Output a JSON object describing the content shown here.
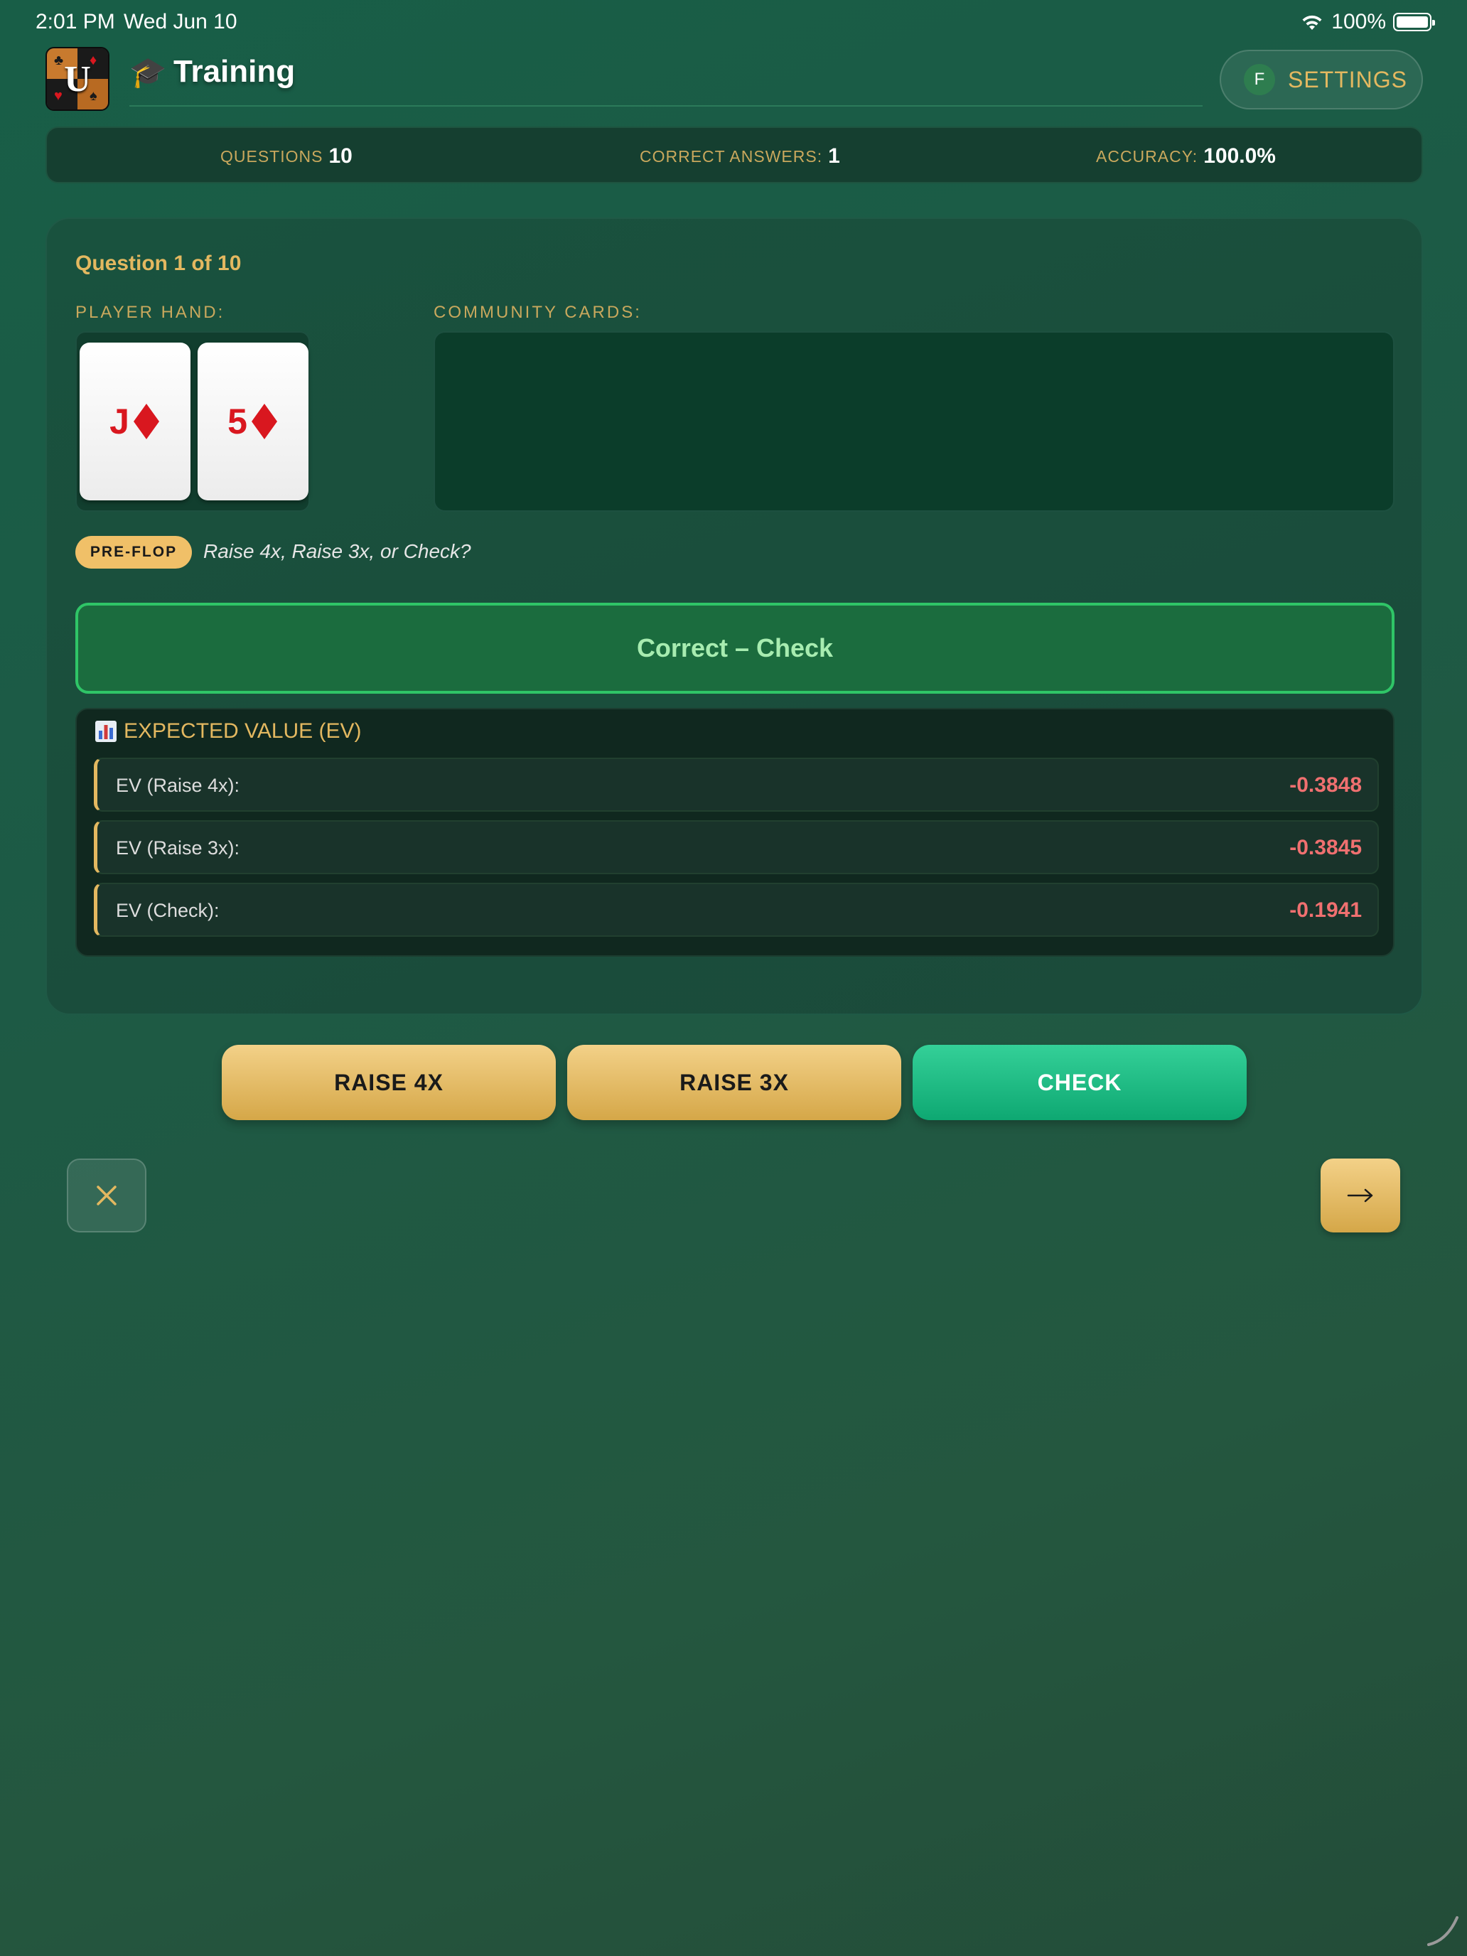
{
  "status_bar": {
    "time": "2:01 PM",
    "date": "Wed Jun 10",
    "battery": "100%"
  },
  "header": {
    "logo_letter": "U",
    "title": "Training",
    "settings_avatar": "F",
    "settings_label": "SETTINGS"
  },
  "stats": [
    {
      "label": "QUESTIONS",
      "value": "10"
    },
    {
      "label": "CORRECT ANSWERS:",
      "value": "1"
    },
    {
      "label": "ACCURACY:",
      "value": "100.0%"
    }
  ],
  "question": {
    "label": "Question 1 of 10"
  },
  "player_hand": {
    "label": "PLAYER HAND:",
    "cards": [
      {
        "rank": "J",
        "suit": "diamond"
      },
      {
        "rank": "5",
        "suit": "diamond"
      }
    ]
  },
  "community": {
    "label": "COMMUNITY CARDS:"
  },
  "phase": {
    "badge": "PRE-FLOP",
    "prompt": "Raise 4x, Raise 3x, or Check?"
  },
  "result": {
    "text": "Correct – Check"
  },
  "ev": {
    "title": "EXPECTED VALUE (EV)",
    "rows": [
      {
        "label": "EV (Raise 4x):",
        "value": "-0.3848"
      },
      {
        "label": "EV (Raise 3x):",
        "value": "-0.3845"
      },
      {
        "label": "EV (Check):",
        "value": "-0.1941"
      }
    ]
  },
  "actions": {
    "raise4": "RAISE 4X",
    "raise3": "RAISE 3X",
    "check": "CHECK"
  },
  "colors": {
    "accent_gold": "#e3b860",
    "correct_green": "#2fc567",
    "ev_negative": "#f07070",
    "card_red": "#d9171f"
  },
  "icons": {
    "cap": "graduation-cap-icon",
    "chart": "bar-chart-icon",
    "close": "close-icon",
    "next": "arrow-right-icon"
  }
}
